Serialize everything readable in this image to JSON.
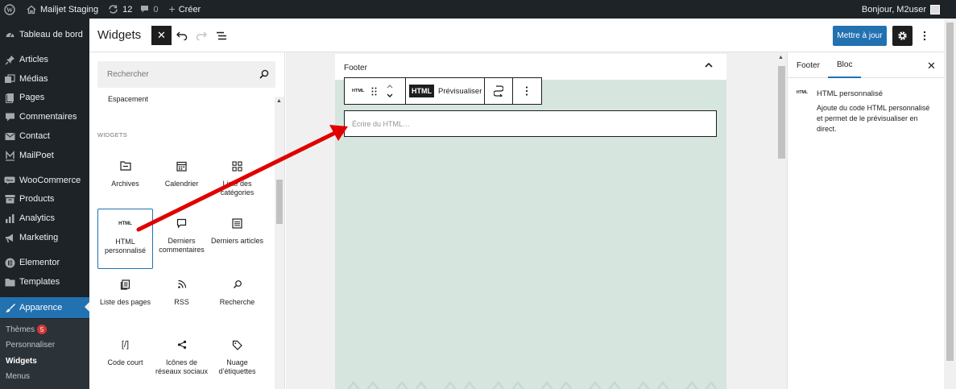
{
  "admin_bar": {
    "site_name": "Mailjet Staging",
    "updates_count": "12",
    "comments_count": "0",
    "new_label": "Créer",
    "greeting": "Bonjour, M2user"
  },
  "sidebar": {
    "items": [
      {
        "label": "Tableau de bord",
        "icon": "dashboard-icon"
      },
      {
        "label": "Articles",
        "icon": "pin-icon"
      },
      {
        "label": "Médias",
        "icon": "media-icon"
      },
      {
        "label": "Pages",
        "icon": "page-icon"
      },
      {
        "label": "Commentaires",
        "icon": "comment-icon"
      },
      {
        "label": "Contact",
        "icon": "mail-icon"
      },
      {
        "label": "MailPoet",
        "icon": "mailpoet-icon"
      },
      {
        "label": "WooCommerce",
        "icon": "woocommerce-icon"
      },
      {
        "label": "Products",
        "icon": "archive-icon"
      },
      {
        "label": "Analytics",
        "icon": "bar-chart-icon"
      },
      {
        "label": "Marketing",
        "icon": "megaphone-icon"
      },
      {
        "label": "Elementor",
        "icon": "elementor-icon"
      },
      {
        "label": "Templates",
        "icon": "folder-icon"
      },
      {
        "label": "Apparence",
        "icon": "brush-icon"
      }
    ],
    "submenu": [
      {
        "label": "Thèmes",
        "badge": "5"
      },
      {
        "label": "Personnaliser"
      },
      {
        "label": "Widgets"
      },
      {
        "label": "Menus"
      }
    ]
  },
  "header": {
    "title": "Widgets",
    "update_label": "Mettre à jour"
  },
  "inserter": {
    "search_placeholder": "Rechercher",
    "partial_item": "Espacement",
    "section_title": "WIDGETS",
    "blocks": [
      {
        "label": "Archives",
        "icon": "archive-folder-icon"
      },
      {
        "label": "Calendrier",
        "icon": "calendar-icon"
      },
      {
        "label": "Liste des catégories",
        "icon": "categories-icon"
      },
      {
        "label": "HTML personnalisé",
        "icon": "html-icon",
        "icon_text": "HTML",
        "selected": true
      },
      {
        "label": "Derniers commentaires",
        "icon": "comment-bubble-icon"
      },
      {
        "label": "Derniers articles",
        "icon": "list-icon"
      },
      {
        "label": "Liste des pages",
        "icon": "pages-list-icon"
      },
      {
        "label": "RSS",
        "icon": "rss-icon"
      },
      {
        "label": "Recherche",
        "icon": "search-icon"
      },
      {
        "label": "Code court",
        "icon": "shortcode-icon",
        "icon_text": "[/]"
      },
      {
        "label": "Icônes de réseaux sociaux",
        "icon": "share-icon"
      },
      {
        "label": "Nuage d’étiquettes",
        "icon": "tag-icon"
      }
    ]
  },
  "canvas": {
    "area_title": "Footer",
    "toolbar": {
      "block_icon_text": "HTML",
      "html_tab": "HTML",
      "preview_tab": "Prévisualiser"
    },
    "html_placeholder": "Écrire du HTML…"
  },
  "settings": {
    "tabs": [
      "Footer",
      "Bloc"
    ],
    "active_tab": "Bloc",
    "block_icon_text": "HTML",
    "block_title": "HTML personnalisé",
    "block_description": "Ajoute du code HTML personnalisé et permet de le prévisualiser en direct."
  },
  "colors": {
    "admin_dark": "#1d2327",
    "wp_blue": "#2271b1",
    "widget_area_bg": "#d6e6df",
    "annotation_arrow": "#e00000"
  }
}
